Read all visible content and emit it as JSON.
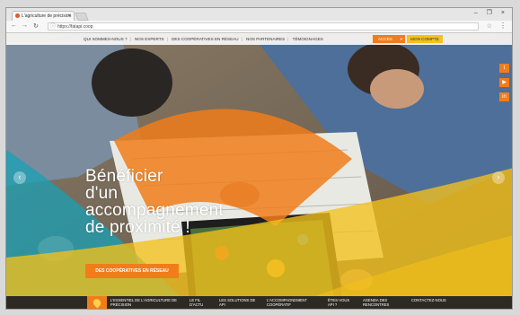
{
  "browser": {
    "tab_title": "L'agriculture de précision",
    "tab_close": "×",
    "url": "https://fatapi.coop",
    "window_controls": "– ❐ ×"
  },
  "topnav": {
    "links": [
      "QUI SOMMES-NOUS ?",
      "NOS EXPERTS",
      "DES COOPÉRATIVES EN RÉSEAU",
      "NOS PARTENAIRES",
      "TÉMOIGNAGES"
    ],
    "acces_label": "ACCÈS",
    "compte_label": "MON COMPTE"
  },
  "social": [
    "twitter-icon",
    "youtube-icon",
    "linkedin-icon"
  ],
  "hero": {
    "title_lines": [
      "Bénéficier",
      "d'un",
      "accompagnement",
      "de proximité !"
    ],
    "cta_label": "DES COOPÉRATIVES EN RÉSEAU"
  },
  "bottom_nav": [
    "L'ESSENTIEL DE L'AGRICULTURE DE PRÉCISION",
    "LE FIL D'ACTU",
    "LES SOLUTIONS DE API",
    "L'ACCOMPAGNEMENT COOPÉRATIF",
    "ÊTES-VOUS API ?",
    "AGENDA DES RENCONTRES",
    "CONTACTEZ-NOUS"
  ],
  "colors": {
    "orange": "#f07d1a",
    "yellow": "#f4c21b",
    "teal": "#1aa0b4",
    "dark": "#2d2a24"
  }
}
